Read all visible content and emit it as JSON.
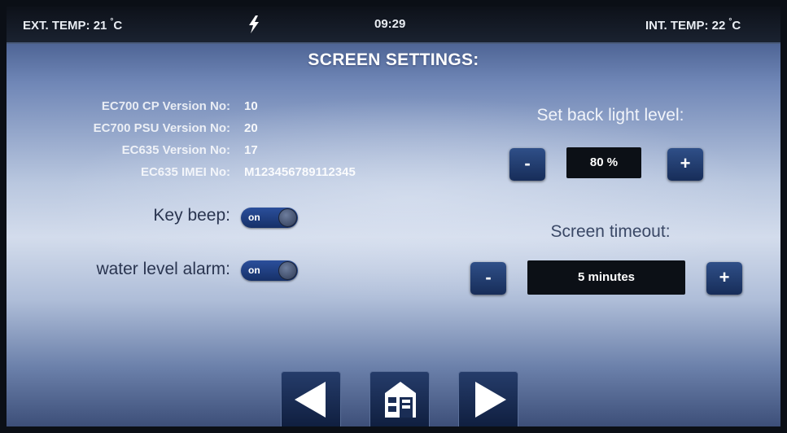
{
  "status_bar": {
    "ext_temp_label": "EXT. TEMP:",
    "ext_temp_value": "21",
    "int_temp_label": "INT. TEMP:",
    "int_temp_value": "22",
    "temp_unit": "C",
    "time": "09:29",
    "power_icon": "lightning-bolt-icon"
  },
  "title": "SCREEN SETTINGS:",
  "info": [
    {
      "label": "EC700 CP Version No:",
      "value": "10"
    },
    {
      "label": "EC700 PSU Version No:",
      "value": "20"
    },
    {
      "label": "EC635 Version No:",
      "value": "17"
    },
    {
      "label": "EC635 IMEI No:",
      "value": "M123456789112345"
    }
  ],
  "options": {
    "key_beep": {
      "label": "Key beep:",
      "state": "on"
    },
    "water_level_alarm": {
      "label": "water level alarm:",
      "state": "on"
    }
  },
  "backlight": {
    "label": "Set back light level:",
    "value": "80 %",
    "minus": "-",
    "plus": "+"
  },
  "timeout": {
    "label": "Screen timeout:",
    "value": "5 minutes",
    "minus": "-",
    "plus": "+"
  },
  "nav": {
    "back_icon": "left-arrow-icon",
    "home_icon": "home-icon",
    "forward_icon": "right-arrow-icon"
  },
  "colors": {
    "button": "#1f3a6e",
    "status_bar": "#121822",
    "toggle_on": "#1e3f85"
  }
}
